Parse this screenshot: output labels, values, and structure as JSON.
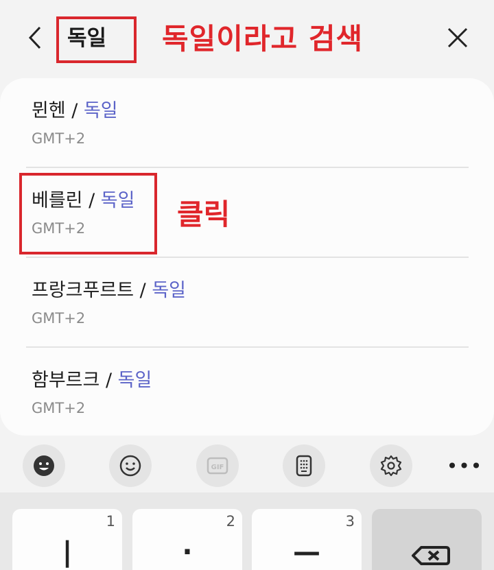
{
  "search": {
    "query": "독일",
    "annotation": "독일이라고 검색"
  },
  "results": [
    {
      "city": "뮌헨",
      "separator": " / ",
      "country": "독일",
      "timezone": "GMT+2"
    },
    {
      "city": "베를린",
      "separator": " / ",
      "country": "독일",
      "timezone": "GMT+2"
    },
    {
      "city": "프랑크푸르트",
      "separator": " / ",
      "country": "독일",
      "timezone": "GMT+2"
    },
    {
      "city": "함부르크",
      "separator": " / ",
      "country": "독일",
      "timezone": "GMT+2"
    }
  ],
  "click_annotation": "클릭",
  "toolbar": {
    "items": [
      "sticker-icon",
      "emoji-icon",
      "gif-icon",
      "keypad-icon",
      "settings-icon",
      "more-icon"
    ],
    "more_label": "•••"
  },
  "keyboard": {
    "keys": [
      {
        "number": "1",
        "glyph": "|"
      },
      {
        "number": "2",
        "glyph": "·"
      },
      {
        "number": "3",
        "glyph": "—"
      }
    ]
  },
  "colors": {
    "accent_red": "#e0262b",
    "country_blue": "#5b63c8"
  }
}
